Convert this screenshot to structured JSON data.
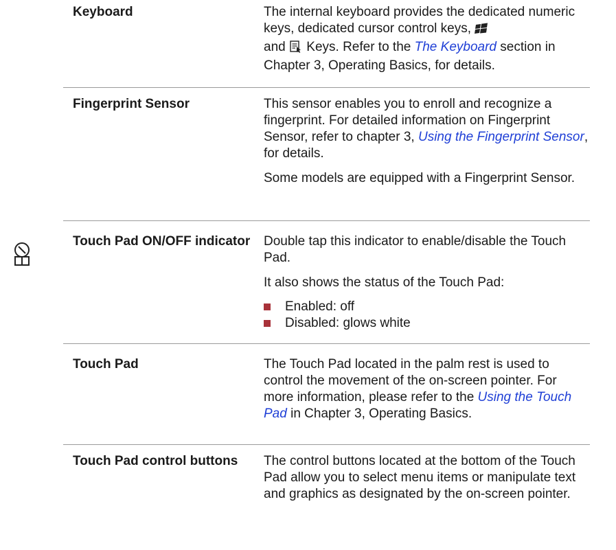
{
  "rows": [
    {
      "term": "Keyboard",
      "desc": {
        "line_a": "The internal keyboard provides the dedicated numeric keys, dedicated cursor control keys,",
        "line_b_and": "and",
        "line_b_keys": "Keys. Refer to the",
        "link": "The Keyboard",
        "line_c": "section in Chapter 3, Operating Basics, for details."
      }
    },
    {
      "term": "Fingerprint Sensor",
      "desc": {
        "p1_a": "This sensor enables you to enroll and recognize a fingerprint. For detailed information on Fingerprint Sensor, refer to chapter 3,",
        "p1_link": "Using the Fingerprint Sensor",
        "p1_b": ", for details.",
        "p2": "Some models are equipped with a Fingerprint Sensor."
      }
    },
    {
      "term": "Touch Pad ON/OFF indicator",
      "desc": {
        "p1": "Double tap this indicator to enable/disable the Touch Pad.",
        "p2": "It also shows the status of the Touch Pad:",
        "bullets": [
          "Enabled: off",
          "Disabled: glows white"
        ]
      }
    },
    {
      "term": "Touch Pad",
      "desc": {
        "p1_a": "The Touch Pad located in the palm rest is used to control the movement of the on-screen pointer. For more information, please refer to the",
        "p1_link": "Using the Touch Pad",
        "p1_b": "in Chapter 3, Operating Basics."
      }
    },
    {
      "term": "Touch Pad control buttons",
      "desc": {
        "p1": "The control buttons located at the bottom of the Touch Pad allow you to select menu items or manipulate text and graphics as designated by the on-screen pointer."
      }
    }
  ],
  "icons": {
    "windows_key": "windows-logo-icon",
    "app_key": "application-key-icon",
    "touchpad_indicator": "touchpad-indicator-icon"
  },
  "colors": {
    "link": "#1f3fd6",
    "bullet": "#a8323a",
    "divider": "#9a9a9a"
  }
}
